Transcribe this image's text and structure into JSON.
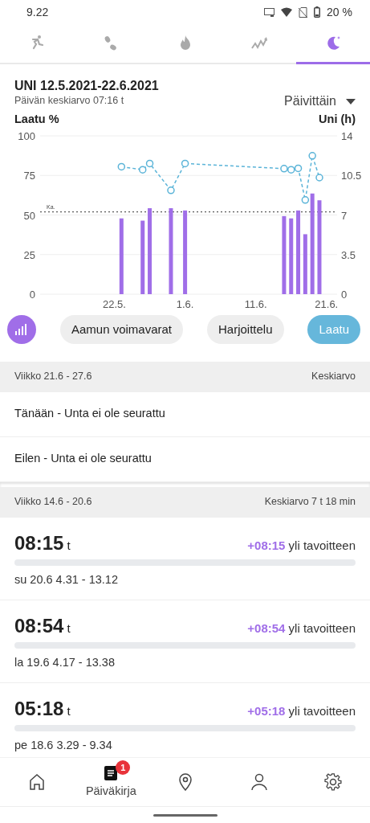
{
  "status_bar": {
    "time": "9.22",
    "battery": "20 %"
  },
  "tabs": [
    {
      "kind": "activity",
      "selected": false
    },
    {
      "kind": "steps",
      "selected": false
    },
    {
      "kind": "calories",
      "selected": false
    },
    {
      "kind": "training",
      "selected": false
    },
    {
      "kind": "sleep",
      "selected": true
    }
  ],
  "summary": {
    "title": "UNI 12.5.2021-22.6.2021",
    "subtitle": "Päivän keskiarvo 07:16 t",
    "period_dropdown": "Päivittäin"
  },
  "chart": {
    "chart_data": {
      "type": "bar",
      "categories": [
        null,
        null,
        null,
        null,
        null,
        null,
        null,
        null,
        null,
        null,
        "22.5.",
        null,
        null,
        null,
        null,
        null,
        null,
        null,
        null,
        null,
        "1.6.",
        null,
        null,
        null,
        null,
        null,
        null,
        null,
        null,
        null,
        "11.6.",
        null,
        null,
        null,
        null,
        null,
        null,
        null,
        null,
        null,
        "21.6.",
        null
      ],
      "grid": true,
      "ylim": [
        0,
        100
      ],
      "yticks": [
        0,
        25,
        50,
        75,
        100
      ],
      "y2lim": [
        0,
        14
      ],
      "y2ticks": [
        {
          "value": 0,
          "label": "0"
        },
        {
          "value": 3.5,
          "label": "3.5"
        },
        {
          "value": 7,
          "label": "7"
        },
        {
          "value": 10.5,
          "label": "10.5"
        },
        {
          "value": 14,
          "label": "14"
        }
      ],
      "series": [
        {
          "name": "Uni (h)",
          "axis": "y2",
          "color": "#a06ee8",
          "values": [
            null,
            null,
            null,
            null,
            null,
            null,
            null,
            null,
            null,
            null,
            null,
            6.7,
            null,
            null,
            6.5,
            7.6,
            null,
            null,
            7.6,
            null,
            7.4,
            null,
            null,
            null,
            null,
            null,
            null,
            null,
            null,
            null,
            null,
            null,
            null,
            null,
            6.9,
            6.7,
            7.4,
            5.3,
            8.9,
            8.3,
            null,
            null
          ]
        },
        {
          "name": "Laatu %",
          "type": "line",
          "line_style": "dashed",
          "marker": "circle",
          "color": "#5bb4d8",
          "values": [
            null,
            null,
            null,
            null,
            null,
            null,
            null,
            null,
            null,
            null,
            null,
            80.5,
            null,
            null,
            78.6,
            82.5,
            null,
            null,
            65.6,
            null,
            82.5,
            null,
            null,
            null,
            null,
            null,
            null,
            null,
            null,
            null,
            null,
            null,
            null,
            null,
            79.3,
            78.6,
            79.5,
            59.5,
            87.4,
            73.6,
            null,
            null
          ]
        }
      ],
      "ref_lines": [
        {
          "axis": "y2",
          "value": 7.27,
          "label": "Ka."
        }
      ]
    }
  },
  "chips": [
    {
      "kind": "icon",
      "selected": false
    },
    {
      "kind": "text",
      "label": "Aamun voimavarat",
      "selected": false
    },
    {
      "kind": "text",
      "label": "Harjoittelu",
      "selected": false
    },
    {
      "kind": "text",
      "label": "Laatu",
      "selected": true
    }
  ],
  "weeks": [
    {
      "range": "Viikko 21.6 - 27.6",
      "average": "Keskiarvo",
      "entries": [
        {
          "kind": "untracked",
          "text": "Tänään - Unta ei ole seurattu"
        },
        {
          "kind": "untracked",
          "text": "Eilen - Unta ei ole seurattu"
        }
      ]
    },
    {
      "range": "Viikko 14.6 - 20.6",
      "average": "Keskiarvo 7 t 18 min",
      "entries": [
        {
          "kind": "sleep",
          "duration": "08:15",
          "unit": "t",
          "delta": "+08:15",
          "delta_text": "yli tavoitteen",
          "period": "su 20.6 4.31 - 13.12"
        },
        {
          "kind": "sleep",
          "duration": "08:54",
          "unit": "t",
          "delta": "+08:54",
          "delta_text": "yli tavoitteen",
          "period": "la 19.6 4.17 - 13.38"
        },
        {
          "kind": "sleep",
          "duration": "05:18",
          "unit": "t",
          "delta": "+05:18",
          "delta_text": "yli tavoitteen",
          "period": "pe 18.6 3.29 - 9.34"
        }
      ]
    }
  ],
  "bottom_nav": [
    {
      "kind": "home",
      "selected": false
    },
    {
      "kind": "diary",
      "label": "Päiväkirja",
      "badge": "1",
      "selected": true
    },
    {
      "kind": "location",
      "selected": false
    },
    {
      "kind": "profile",
      "selected": false
    },
    {
      "kind": "settings",
      "selected": false
    }
  ]
}
